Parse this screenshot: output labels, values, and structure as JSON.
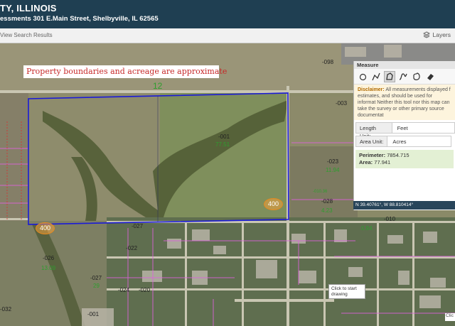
{
  "header": {
    "title": "TY, ILLINOIS",
    "address": "essments 301 E.Main Street, Shelbyville, IL 62565"
  },
  "toolbar": {
    "back_label": "View Search Results",
    "layers_label": "Layers",
    "layers_icon": "layers-icon"
  },
  "map": {
    "banner": "Property boundaries and acreage are approximate",
    "road_label": "12",
    "parcels": [
      {
        "id": "-001",
        "acres": "77.51"
      },
      {
        "id": "-003",
        "acres": ""
      },
      {
        "id": "-023",
        "acres": "11.94"
      },
      {
        "id": "-028",
        "acres": "4.23"
      },
      {
        "id": "-026",
        "acres": "13.09"
      },
      {
        "id": "-027",
        "acres": "29"
      },
      {
        "id": "-024",
        "acres": ""
      },
      {
        "id": "-020",
        "acres": ""
      },
      {
        "id": "-022",
        "acres": ""
      },
      {
        "id": "-027",
        "acres": ""
      },
      {
        "id": "-032",
        "acres": ""
      },
      {
        "id": "-001",
        "acres": ""
      },
      {
        "id": "-098",
        "acres": ""
      },
      {
        "id": "-010",
        "acres": ""
      },
      {
        "id": "0.84",
        "acres": ""
      },
      {
        "id": "-010.36",
        "acres": ""
      }
    ],
    "badges": [
      "400",
      "400"
    ],
    "tooltip": "Click to start drawing",
    "click_stub": "Clic"
  },
  "measure_panel": {
    "title": "Measure",
    "tools": [
      "circle-tool-icon",
      "polyline-tool-icon",
      "freehand-area-tool-icon",
      "freehand-line-tool-icon",
      "polygon-tool-icon",
      "eraser-tool-icon"
    ],
    "active_tool": 2,
    "disclaimer_label": "Disclaimer:",
    "disclaimer_text": "All measurements displayed f estimates, and should be used for informat Neither this tool nor this map can take the survey or other primary source documentat",
    "length_unit_label": "Length Unit:",
    "length_unit_value": "Feet",
    "area_unit_label": "Area Unit:",
    "area_unit_value": "Acres",
    "perimeter_label": "Perimeter:",
    "perimeter_value": "7854.715",
    "area_label": "Area:",
    "area_value": "77.941",
    "coordinates": "N 39.40761°, W 88.810414°"
  },
  "colors": {
    "header_bg": "#1f3f52",
    "boundary": "#1a1ad8",
    "parcel_lines": "#e060e0",
    "acre_text": "#2e9e2e",
    "banner_text": "#c62828"
  }
}
